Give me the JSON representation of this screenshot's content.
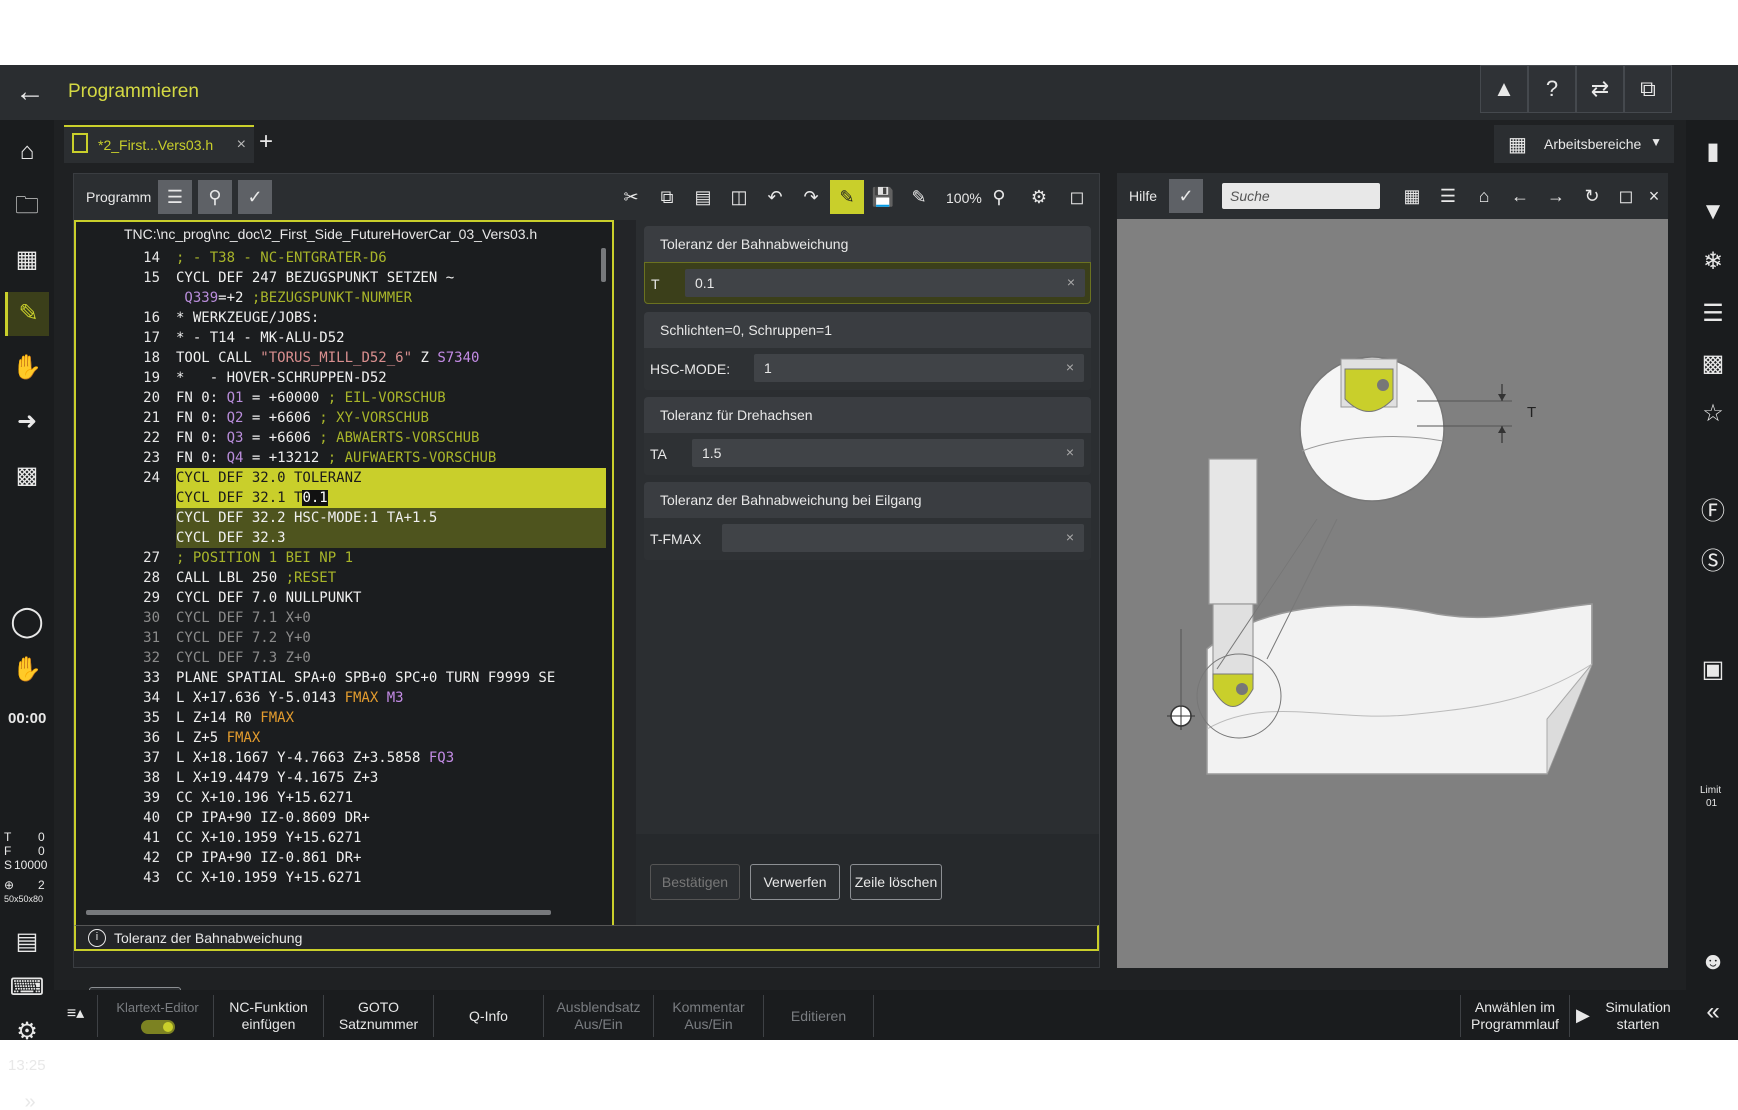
{
  "titlebar": {
    "title": "Programmieren",
    "back_icon": "arrow-left-icon"
  },
  "tabs": {
    "active_file": "*2_First...Vers03.h",
    "add_label": "+",
    "workspaces_label": "Arbeitsbereiche"
  },
  "program_pane": {
    "title": "Programm",
    "zoom": "100%",
    "path": "TNC:\\nc_prog\\nc_doc\\2_First_Side_FutureHoverCar_03_Vers03.h"
  },
  "code_lines": [
    {
      "n": "14",
      "segments": [
        {
          "t": "; - T38 - NC-ENTGRATER-D6",
          "c": "cm"
        }
      ]
    },
    {
      "n": "15",
      "segments": [
        {
          "t": "CYCL DEF 247 BEZUGSPUNKT SETZEN ~",
          "c": ""
        }
      ]
    },
    {
      "n": "",
      "segments": [
        {
          "t": " Q339",
          "c": "q"
        },
        {
          "t": "=+2 ",
          "c": ""
        },
        {
          "t": ";BEZUGSPUNKT-NUMMER",
          "c": "cm"
        }
      ]
    },
    {
      "n": "16",
      "segments": [
        {
          "t": "* WERKZEUGE/JOBS:",
          "c": ""
        }
      ]
    },
    {
      "n": "17",
      "segments": [
        {
          "t": "* - T14 - MK-ALU-D52",
          "c": ""
        }
      ]
    },
    {
      "n": "18",
      "segments": [
        {
          "t": "TOOL CALL ",
          "c": ""
        },
        {
          "t": "\"TORUS_MILL_D52_6\"",
          "c": "str"
        },
        {
          "t": " Z ",
          "c": ""
        },
        {
          "t": "S7340",
          "c": "pu"
        }
      ]
    },
    {
      "n": "19",
      "segments": [
        {
          "t": "*   - HOVER-SCHRUPPEN-D52",
          "c": ""
        }
      ]
    },
    {
      "n": "20",
      "segments": [
        {
          "t": "FN 0: ",
          "c": ""
        },
        {
          "t": "Q1",
          "c": "q"
        },
        {
          "t": " = +60000 ",
          "c": ""
        },
        {
          "t": "; EIL-VORSCHUB",
          "c": "cm"
        }
      ]
    },
    {
      "n": "21",
      "segments": [
        {
          "t": "FN 0: ",
          "c": ""
        },
        {
          "t": "Q2",
          "c": "q"
        },
        {
          "t": " = +6606 ",
          "c": ""
        },
        {
          "t": "; XY-VORSCHUB",
          "c": "cm"
        }
      ]
    },
    {
      "n": "22",
      "segments": [
        {
          "t": "FN 0: ",
          "c": ""
        },
        {
          "t": "Q3",
          "c": "q"
        },
        {
          "t": " = +6606 ",
          "c": ""
        },
        {
          "t": "; ABWAERTS-VORSCHUB",
          "c": "cm"
        }
      ]
    },
    {
      "n": "23",
      "segments": [
        {
          "t": "FN 0: ",
          "c": ""
        },
        {
          "t": "Q4",
          "c": "q"
        },
        {
          "t": " = +13212 ",
          "c": ""
        },
        {
          "t": "; AUFWAERTS-VORSCHUB",
          "c": "cm"
        }
      ]
    },
    {
      "n": "24",
      "segments": [
        {
          "t": "CYCL DEF 32.0 TOLERANZ",
          "c": ""
        }
      ],
      "hl": "strong"
    },
    {
      "n": "",
      "segments": [
        {
          "t": "CYCL DEF 32.1 T",
          "c": ""
        },
        {
          "t": "0.1",
          "c": "cursor"
        }
      ],
      "hl": "strong"
    },
    {
      "n": "",
      "segments": [
        {
          "t": "CYCL DEF 32.2 HSC-MODE:1 TA+1.5",
          "c": ""
        }
      ],
      "hl": "weak"
    },
    {
      "n": "",
      "segments": [
        {
          "t": "CYCL DEF 32.3",
          "c": ""
        }
      ],
      "hl": "weak"
    },
    {
      "n": "27",
      "segments": [
        {
          "t": "; POSITION 1 BEI NP 1",
          "c": "cm"
        }
      ]
    },
    {
      "n": "28",
      "segments": [
        {
          "t": "CALL LBL 250 ",
          "c": ""
        },
        {
          "t": ";RESET",
          "c": "cm"
        }
      ]
    },
    {
      "n": "29",
      "segments": [
        {
          "t": "CYCL DEF 7.0 NULLPUNKT",
          "c": ""
        }
      ]
    },
    {
      "n": "30",
      "segments": [
        {
          "t": "CYCL DEF 7.1 X+0",
          "c": ""
        }
      ],
      "gray": true
    },
    {
      "n": "31",
      "segments": [
        {
          "t": "CYCL DEF 7.2 Y+0",
          "c": ""
        }
      ],
      "gray": true
    },
    {
      "n": "32",
      "segments": [
        {
          "t": "CYCL DEF 7.3 Z+0",
          "c": ""
        }
      ],
      "gray": true
    },
    {
      "n": "33",
      "segments": [
        {
          "t": "PLANE SPATIAL SPA+0 SPB+0 SPC+0 TURN F9999 SE",
          "c": ""
        }
      ]
    },
    {
      "n": "34",
      "segments": [
        {
          "t": "L X+17.636 Y-5.0143 ",
          "c": ""
        },
        {
          "t": "FMAX",
          "c": "or"
        },
        {
          "t": " ",
          "c": ""
        },
        {
          "t": "M3",
          "c": "pu"
        }
      ]
    },
    {
      "n": "35",
      "segments": [
        {
          "t": "L Z+14 R0 ",
          "c": ""
        },
        {
          "t": "FMAX",
          "c": "or"
        }
      ]
    },
    {
      "n": "36",
      "segments": [
        {
          "t": "L Z+5 ",
          "c": ""
        },
        {
          "t": "FMAX",
          "c": "or"
        }
      ]
    },
    {
      "n": "37",
      "segments": [
        {
          "t": "L X+18.1667 Y-4.7663 Z+3.5858 ",
          "c": ""
        },
        {
          "t": "FQ3",
          "c": "pu"
        }
      ]
    },
    {
      "n": "38",
      "segments": [
        {
          "t": "L X+19.4479 Y-4.1675 Z+3",
          "c": ""
        }
      ]
    },
    {
      "n": "39",
      "segments": [
        {
          "t": "CC X+10.196 Y+15.6271",
          "c": ""
        }
      ]
    },
    {
      "n": "40",
      "segments": [
        {
          "t": "CP IPA+90 IZ-0.8609 DR+",
          "c": ""
        }
      ]
    },
    {
      "n": "41",
      "segments": [
        {
          "t": "CC X+10.1959 Y+15.6271",
          "c": ""
        }
      ]
    },
    {
      "n": "42",
      "segments": [
        {
          "t": "CP IPA+90 IZ-0.861 DR+",
          "c": ""
        }
      ]
    },
    {
      "n": "43",
      "segments": [
        {
          "t": "CC X+10.1959 Y+15.6271",
          "c": ""
        }
      ]
    }
  ],
  "form": {
    "groups": [
      {
        "title": "Toleranz der Bahnabweichung",
        "label": "T",
        "value": "0.1"
      },
      {
        "title": "Schlichten=0, Schruppen=1",
        "label": "HSC-MODE:",
        "value": "1"
      },
      {
        "title": "Toleranz für Drehachsen",
        "label": "TA",
        "value": "1.5"
      },
      {
        "title": "Toleranz der Bahnabweichung bei Eilgang",
        "label": "T-FMAX",
        "value": ""
      }
    ],
    "confirm_label": "Bestätigen",
    "discard_label": "Verwerfen",
    "delete_label": "Zeile löschen"
  },
  "info_bar": {
    "text": "Toleranz der Bahnabweichung",
    "info_icon": "info-icon"
  },
  "softkey": {
    "t_label": "T"
  },
  "help": {
    "title": "Hilfe",
    "search_placeholder": "Suche",
    "figure_label": "T"
  },
  "left_status": {
    "t_label": "T",
    "t_value": "0",
    "f_label": "F",
    "f_value": "0",
    "s_label": "S",
    "s_value": "10000",
    "ref_value": "2",
    "blank_size": "50x50x80",
    "timer": "00:00",
    "clock": "13:25"
  },
  "right_status": {
    "limit_label": "Limit",
    "limit_value": "01"
  },
  "bottombar": {
    "klartext_label": "Klartext-Editor",
    "nc_func_line1": "NC-Funktion",
    "nc_func_line2": "einfügen",
    "goto_line1": "GOTO",
    "goto_line2": "Satznummer",
    "qinfo_label": "Q-Info",
    "ausblend_line1": "Ausblendsatz",
    "ausblend_line2": "Aus/Ein",
    "kommentar_line1": "Kommentar",
    "kommentar_line2": "Aus/Ein",
    "editieren_label": "Editieren",
    "anwaehlen_line1": "Anwählen im",
    "anwaehlen_line2": "Programmlauf",
    "simulation_line1": "Simulation",
    "simulation_line2": "starten"
  },
  "colors": {
    "accent": "#c9cf2b",
    "background": "#1f2123",
    "panel": "#2b2e31"
  }
}
